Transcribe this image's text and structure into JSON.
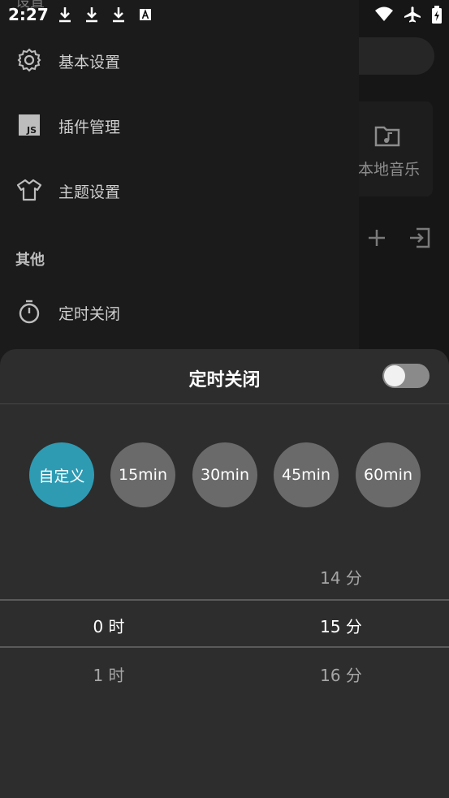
{
  "status_bar": {
    "time": "2:27",
    "left_icons": [
      "download-icon",
      "download-icon",
      "download-icon",
      "font-icon"
    ],
    "right_icons": [
      "wifi-icon",
      "airplane-icon",
      "battery-charging-icon"
    ]
  },
  "drawer": {
    "cut_title": "设置",
    "items": [
      {
        "label": "基本设置",
        "icon": "gear-icon"
      },
      {
        "label": "插件管理",
        "icon": "js-icon"
      },
      {
        "label": "主题设置",
        "icon": "shirt-icon"
      }
    ],
    "section_other": "其他",
    "other_items": [
      {
        "label": "定时关闭",
        "icon": "timer-icon"
      }
    ]
  },
  "background": {
    "card_label": "本地音乐"
  },
  "sheet": {
    "title": "定时关闭",
    "toggle_on": false,
    "presets": [
      {
        "label": "自定义",
        "selected": true
      },
      {
        "label": "15min",
        "selected": false
      },
      {
        "label": "30min",
        "selected": false
      },
      {
        "label": "45min",
        "selected": false
      },
      {
        "label": "60min",
        "selected": false
      }
    ],
    "hours": {
      "prev": "",
      "current": "0 时",
      "next": "1 时"
    },
    "minutes": {
      "prev": "14 分",
      "current": "15 分",
      "next": "16 分"
    },
    "accent_color": "#2e9bb3"
  }
}
